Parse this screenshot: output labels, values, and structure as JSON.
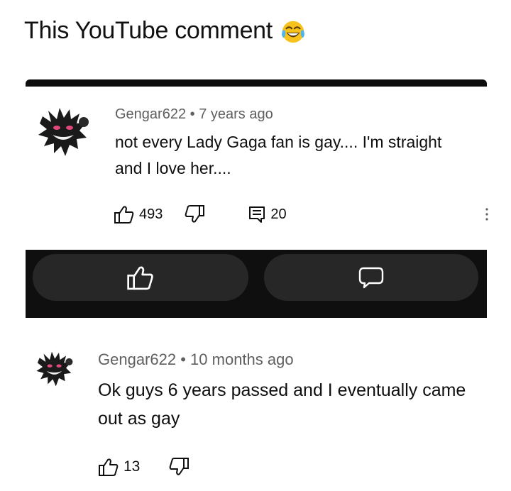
{
  "caption": {
    "text": "This YouTube comment",
    "emoji": "laughing-crying-emoji"
  },
  "comments": [
    {
      "username": "Gengar622",
      "separator": "•",
      "time_ago": "7 years ago",
      "text": "not every Lady Gaga fan is gay.... I'm straight and I love her....",
      "likes": "493",
      "replies": "20"
    },
    {
      "username": "Gengar622",
      "separator": "•",
      "time_ago": "10 months ago",
      "text": "Ok guys 6 years passed and I eventually came out as gay",
      "likes": "13"
    }
  ],
  "reply_bar": {
    "like_icon": "thumbs-up-icon",
    "reply_icon": "comment-bubble-icon"
  },
  "colors": {
    "text_primary": "#0f0f0f",
    "text_meta": "#5f5f5f",
    "dark_band": "#0f0f0f",
    "pill": "#272727"
  }
}
